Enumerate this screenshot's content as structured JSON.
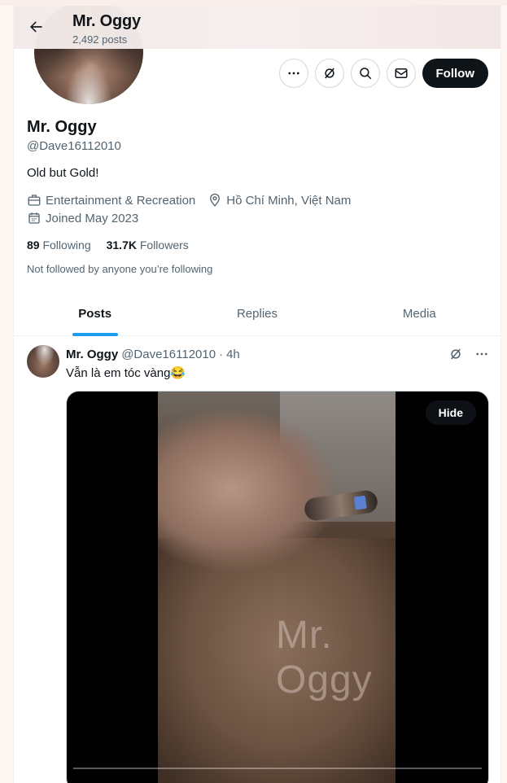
{
  "header": {
    "title": "Mr. Oggy",
    "subtitle": "2,492 posts"
  },
  "profile": {
    "name": "Mr. Oggy",
    "handle": "@Dave16112010",
    "bio": "Old but Gold!",
    "category": "Entertainment & Recreation",
    "location": "Hồ Chí Minh, Việt Nam",
    "joined": "Joined May 2023",
    "following_count": "89",
    "following_label": "Following",
    "followers_count": "31.7K",
    "followers_label": "Followers",
    "not_followed": "Not followed by anyone you’re following",
    "follow_label": "Follow"
  },
  "tabs": [
    {
      "label": "Posts",
      "active": true
    },
    {
      "label": "Replies",
      "active": false
    },
    {
      "label": "Media",
      "active": false
    }
  ],
  "post": {
    "name": "Mr. Oggy",
    "handle": "@Dave16112010",
    "separator": "·",
    "time": "4h",
    "text": "Vẫn là em tóc vàng😂",
    "media_watermark": "Mr. Oggy",
    "hide_label": "Hide",
    "video_progress": 0.0
  },
  "colors": {
    "accent": "#1d9bf0",
    "text": "#0f1419",
    "muted": "#536471"
  },
  "icons": [
    "back-arrow-icon",
    "more-icon",
    "grok-icon",
    "search-icon",
    "message-icon",
    "briefcase-icon",
    "location-icon",
    "calendar-icon"
  ]
}
